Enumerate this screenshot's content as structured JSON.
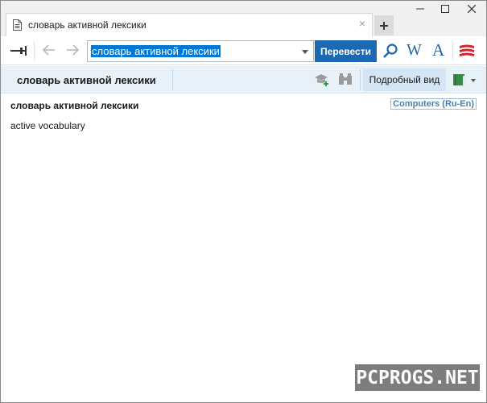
{
  "tab": {
    "title": "словарь активной лексики",
    "close": "×"
  },
  "newtab": {
    "label": "+"
  },
  "search": {
    "value": "словарь активной лексики"
  },
  "toolbar": {
    "translate_label": "Перевести",
    "wiki_label": "W",
    "font_label": "A"
  },
  "subheader": {
    "title": "словарь активной лексики",
    "detail_view_label": "Подробный вид"
  },
  "entry": {
    "headword": "словарь активной лексики",
    "dictionary": "Computers (Ru-En)",
    "translation": "active vocabulary"
  },
  "watermark": {
    "text": "PCPROGS.NET"
  },
  "colors": {
    "accent": "#1c68b3",
    "selection": "#0078d7",
    "subheader_bg": "#e6f1fa",
    "logo_red": "#d4242c"
  }
}
